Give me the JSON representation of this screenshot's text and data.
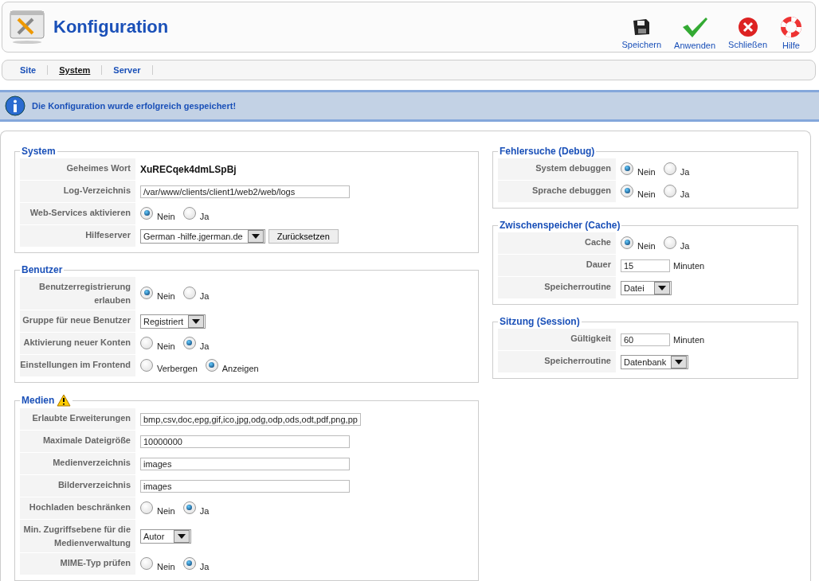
{
  "header": {
    "title": "Konfiguration"
  },
  "toolbar": [
    {
      "kind": "save",
      "label": "Speichern"
    },
    {
      "kind": "apply",
      "label": "Anwenden"
    },
    {
      "kind": "close",
      "label": "Schließen"
    },
    {
      "kind": "help",
      "label": "Hilfe"
    }
  ],
  "tabs": [
    {
      "label": "Site",
      "selected": false
    },
    {
      "label": "System",
      "selected": true
    },
    {
      "label": "Server",
      "selected": false
    }
  ],
  "message": "Die Konfiguration wurde erfolgreich gespeichert!",
  "left_column": [
    {
      "title": "System",
      "rows": [
        {
          "label": "Geheimes Wort",
          "kind": "text",
          "value": "XuRECqek4dmLSpBj"
        },
        {
          "label": "Log-Verzeichnis",
          "kind": "input",
          "value": "/var/www/clients/client1/web2/web/logs"
        },
        {
          "label": "Web-Services aktivieren",
          "kind": "radio",
          "options": [
            {
              "label": "Nein",
              "selected": true
            },
            {
              "label": "Ja",
              "selected": false
            }
          ]
        },
        {
          "label": "Hilfeserver",
          "kind": "select",
          "value": "German -hilfe.jgerman.de",
          "button": "Zurücksetzen"
        }
      ]
    },
    {
      "title": "Benutzer",
      "rows": [
        {
          "label": "Benutzerregistrierung erlauben",
          "kind": "radio",
          "options": [
            {
              "label": "Nein",
              "selected": true
            },
            {
              "label": "Ja",
              "selected": false
            }
          ]
        },
        {
          "label": "Gruppe für neue Benutzer",
          "kind": "select",
          "value": "Registriert"
        },
        {
          "label": "Aktivierung neuer Konten",
          "kind": "radio",
          "options": [
            {
              "label": "Nein",
              "selected": false
            },
            {
              "label": "Ja",
              "selected": true
            }
          ]
        },
        {
          "label": "Einstellungen im Frontend",
          "kind": "radio",
          "options": [
            {
              "label": "Verbergen",
              "selected": false
            },
            {
              "label": "Anzeigen",
              "selected": true
            }
          ]
        }
      ]
    },
    {
      "title": "Medien",
      "warning": true,
      "rows": [
        {
          "label": "Erlaubte Erweiterungen",
          "kind": "input",
          "value": "bmp,csv,doc,epg,gif,ico,jpg,odg,odp,ods,odt,pdf,png,pp"
        },
        {
          "label": "Maximale Dateigröße",
          "kind": "input",
          "value": "10000000"
        },
        {
          "label": "Medienverzeichnis",
          "kind": "input",
          "value": "images"
        },
        {
          "label": "Bilderverzeichnis",
          "kind": "input",
          "value": "images"
        },
        {
          "label": "Hochladen beschränken",
          "kind": "radio",
          "options": [
            {
              "label": "Nein",
              "selected": false
            },
            {
              "label": "Ja",
              "selected": true
            }
          ]
        },
        {
          "label": "Min. Zugriffsebene für die Medienverwaltung",
          "kind": "select",
          "value": "Autor"
        },
        {
          "label": "MIME-Typ prüfen",
          "kind": "radio",
          "options": [
            {
              "label": "Nein",
              "selected": false
            },
            {
              "label": "Ja",
              "selected": true
            }
          ]
        }
      ]
    }
  ],
  "right_column": [
    {
      "title": "Fehlersuche (Debug)",
      "rows": [
        {
          "label": "System debuggen",
          "kind": "radio",
          "options": [
            {
              "label": "Nein",
              "selected": true
            },
            {
              "label": "Ja",
              "selected": false
            }
          ]
        },
        {
          "label": "Sprache debuggen",
          "kind": "radio",
          "options": [
            {
              "label": "Nein",
              "selected": true
            },
            {
              "label": "Ja",
              "selected": false
            }
          ]
        }
      ]
    },
    {
      "title": "Zwischenspeicher (Cache)",
      "rows": [
        {
          "label": "Cache",
          "kind": "radio",
          "options": [
            {
              "label": "Nein",
              "selected": true
            },
            {
              "label": "Ja",
              "selected": false
            }
          ]
        },
        {
          "label": "Dauer",
          "kind": "input_unit",
          "value": "15",
          "unit": "Minuten"
        },
        {
          "label": "Speicherroutine",
          "kind": "select",
          "value": "Datei"
        }
      ]
    },
    {
      "title": "Sitzung (Session)",
      "rows": [
        {
          "label": "Gültigkeit",
          "kind": "input_unit",
          "value": "60",
          "unit": "Minuten"
        },
        {
          "label": "Speicherroutine",
          "kind": "select",
          "value": "Datenbank"
        }
      ]
    }
  ]
}
